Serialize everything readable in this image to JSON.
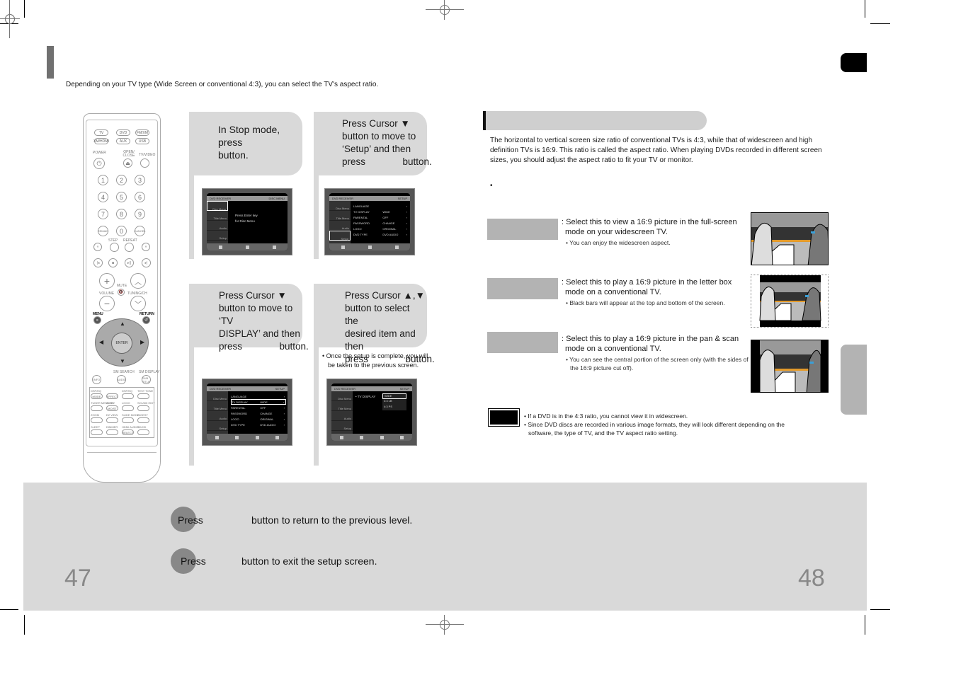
{
  "left_page": {
    "intro": "Depending on your TV type (Wide Screen  or conventional 4:3), you can select the TV's aspect ratio.",
    "page_number": "47"
  },
  "remote": {
    "source_buttons": [
      "TV",
      "DVD",
      "FM/XM",
      "XM/HDMI",
      "AUX",
      "USB"
    ],
    "labels": {
      "power": "POWER",
      "open_close": "OPEN/ CLOSE",
      "tv_video": "TV/VIDEO",
      "step": "STEP",
      "repeat": "REPEAT",
      "volume": "VOLUME",
      "mute": "MUTE",
      "tuning": "TUNING/CH",
      "menu": "MENU",
      "return": "RETURN",
      "enter": "ENTER",
      "sm_search": "SM SEARCH",
      "sm_display": "SM DISPLAY"
    },
    "number_keys": [
      "1",
      "2",
      "3",
      "4",
      "5",
      "6",
      "7",
      "8",
      "9",
      "REMAIN",
      "0",
      "CANCEL"
    ],
    "lower_keys": [
      {
        "label": "MODE",
        "top": "DSP/EQ"
      },
      {
        "label": "EFFECT",
        "top": ""
      },
      {
        "label": "",
        "top": "DSP/EQ"
      },
      {
        "label": "",
        "top": "TEST TONE"
      },
      {
        "label": "",
        "top": "TUNER MEMORY"
      },
      {
        "label": "MO/ST",
        "top": "SLOW"
      },
      {
        "label": "",
        "top": "LOGO"
      },
      {
        "label": "",
        "top": "SOUND EDIT"
      },
      {
        "label": "",
        "top": "ZOOM"
      },
      {
        "label": "",
        "top": "EZ VIEW"
      },
      {
        "label": "",
        "top": "SLIDE MODE"
      },
      {
        "label": "",
        "top": "DIGEST"
      },
      {
        "label": "",
        "top": "SLEEP"
      },
      {
        "label": "",
        "top": "DIMMER"
      },
      {
        "label": "SELECT",
        "top": "HDMI AUDIO"
      },
      {
        "label": "",
        "top": "SD/HD"
      }
    ],
    "info_keys": [
      "INFO",
      "AUDIO",
      "SUB TITLE"
    ]
  },
  "steps": [
    {
      "lines": [
        "In Stop mode,",
        "press",
        "button."
      ]
    },
    {
      "lines": [
        "Press Cursor ▼",
        "button to move to",
        "‘Setup’ and then",
        "press              button."
      ]
    },
    {
      "lines": [
        "Press Cursor ▼",
        "button to move to ‘TV",
        "DISPLAY’ and then",
        "press              button."
      ]
    },
    {
      "lines": [
        "Press Cursor  ▲,▼",
        "button to select the",
        "desired item and then",
        "press              button."
      ]
    }
  ],
  "step4_note": "Once the setup is complete, you will be taken to the previous screen.",
  "osd": {
    "header_left": "DVD RECEIVER",
    "menu1_title": "DISC MENU",
    "setup_title": "SETUP",
    "side_items": [
      "Disc Menu",
      "Title Menu",
      "Audio",
      "Setup"
    ],
    "msg": [
      "Press Enter key",
      "for Disc Menu"
    ],
    "setup_rows": [
      {
        "k": "LANGUAGE",
        "v": ""
      },
      {
        "k": "TV DISPLAY",
        "v": "WIDE"
      },
      {
        "k": "PARENTAL",
        "v": "OFF"
      },
      {
        "k": "PASSWORD",
        "v": "CHANGE"
      },
      {
        "k": "LOGO",
        "v": "ORIGINAL"
      },
      {
        "k": "DVD TYPE",
        "v": "DVD AUDIO"
      }
    ],
    "tv_display_label": "TV DISPLAY",
    "tv_display_options": [
      "WIDE",
      "4:3 LB",
      "4:3 PS"
    ]
  },
  "right_page": {
    "paragraph": "The horizontal to vertical screen size ratio of conventional TVs is 4:3, while that of widescreen and high definition TVs is 16:9. This ratio is called the aspect ratio. When playing DVDs recorded in different screen sizes, you should adjust the aspect ratio to fit your TV or monitor.",
    "bullet": "•",
    "options": [
      {
        "main": ": Select this to view a 16:9 picture in the full-screen mode on your widescreen TV.",
        "sub": "• You can enjoy the widescreen aspect."
      },
      {
        "main": ": Select this to play a 16:9 picture in the letter box mode on a conventional TV.",
        "sub": "• Black bars will appear at the top and bottom of the screen."
      },
      {
        "main": ": Select this to play a 16:9 picture in the pan & scan mode on a conventional TV.",
        "sub": "• You can see the central portion of the screen only (with the sides of the 16:9 picture cut off)."
      }
    ],
    "notes": [
      "• If a DVD is in the 4:3 ratio, you cannot view it in widescreen.",
      "• Since DVD discs are recorded in various image formats, they will look different depending on the software, the type of TV, and the TV aspect ratio setting."
    ],
    "page_number": "48"
  },
  "bottom": {
    "press1": "Press",
    "text1": "button to return to the previous level.",
    "press2": "Press",
    "text2": "button to exit the setup screen."
  }
}
